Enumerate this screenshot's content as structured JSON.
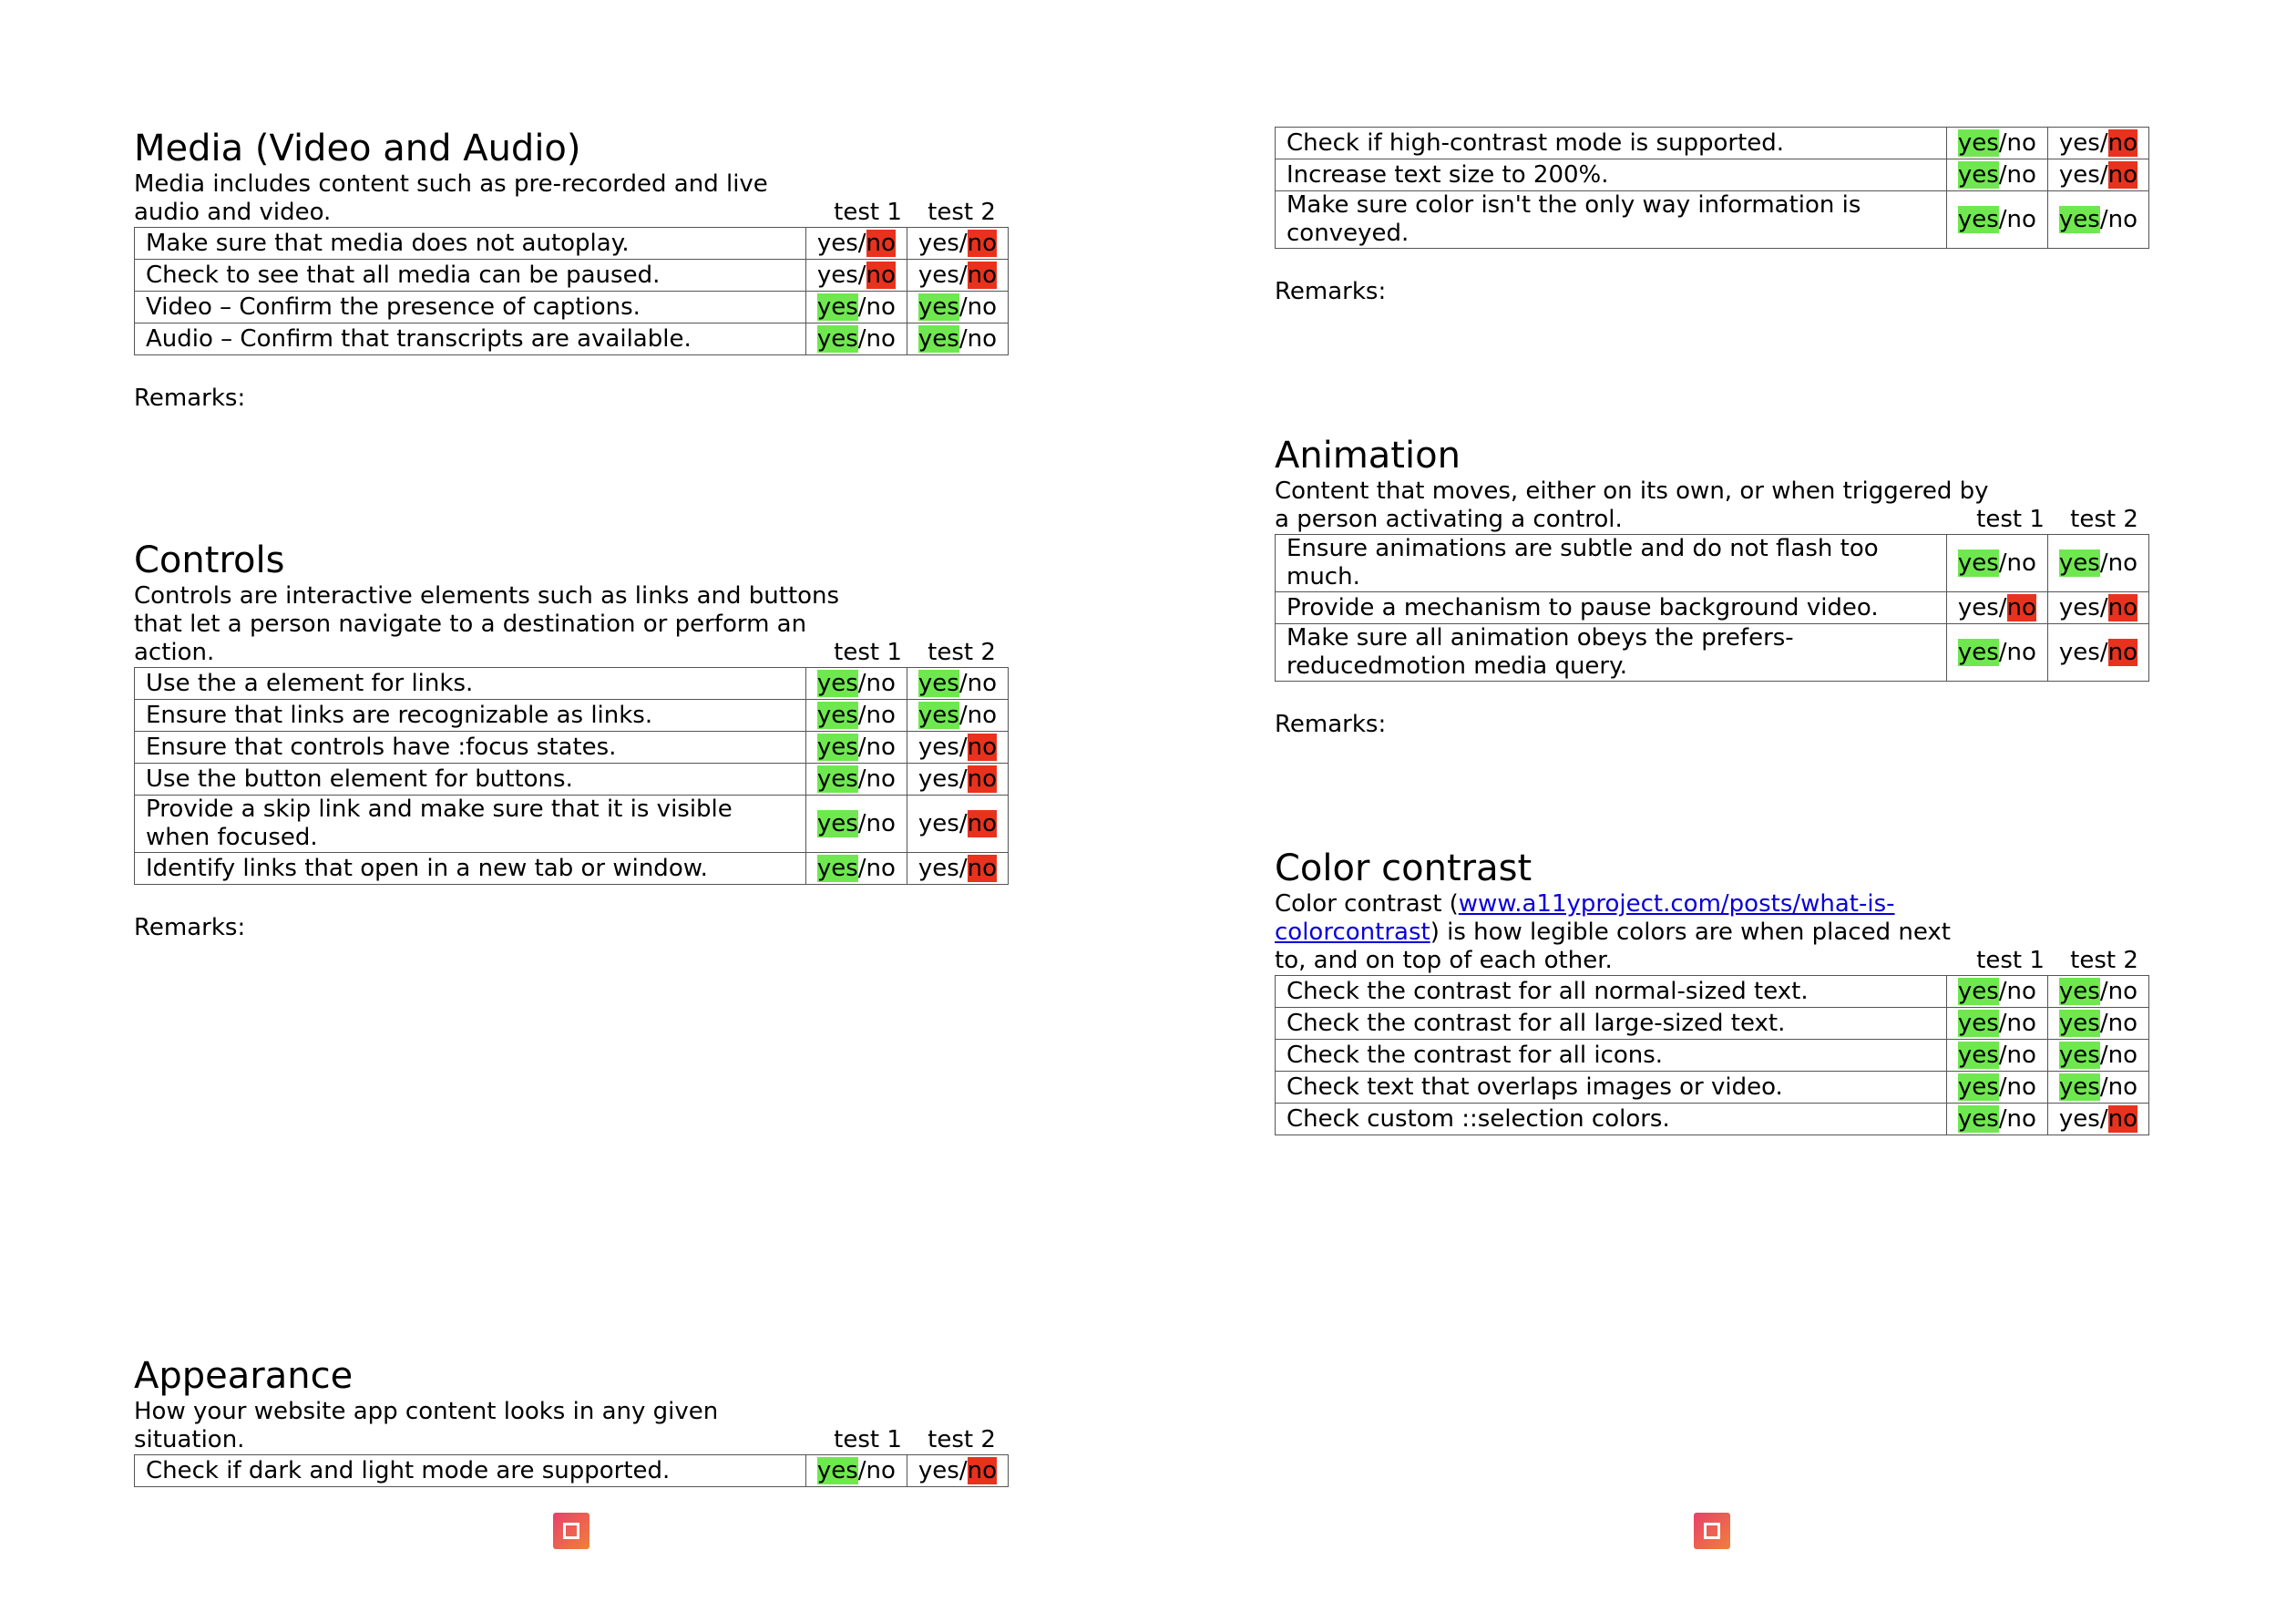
{
  "left_page": {
    "media": {
      "title": "Media (Video and Audio)",
      "description": "Media includes content such as pre-recorded and live audio and video.",
      "headers": [
        "test 1",
        "test 2"
      ],
      "rows": [
        {
          "question": "Make sure that media does not autoplay.",
          "test1": "no",
          "test2": "no"
        },
        {
          "question": "Check to see that all media can be paused.",
          "test1": "no",
          "test2": "no"
        },
        {
          "question": "Video – Confirm the presence of captions.",
          "test1": "yes",
          "test2": "yes"
        },
        {
          "question": "Audio – Confirm that transcripts are available.",
          "test1": "yes",
          "test2": "yes"
        }
      ],
      "remarks": "Remarks:"
    },
    "controls": {
      "title": "Controls",
      "description": "Controls are interactive elements such as links and buttons that let a person navigate to a destination or perform an action.",
      "headers": [
        "test 1",
        "test 2"
      ],
      "rows": [
        {
          "question": "Use the a element for links.",
          "test1": "yes",
          "test2": "yes"
        },
        {
          "question": "Ensure that links are recognizable as links.",
          "test1": "yes",
          "test2": "yes"
        },
        {
          "question": "Ensure that controls have :focus states.",
          "test1": "yes",
          "test2": "no"
        },
        {
          "question": "Use the button element for buttons.",
          "test1": "yes",
          "test2": "no"
        },
        {
          "question": "Provide a skip link and make sure that it is visible when focused.",
          "test1": "yes",
          "test2": "no"
        },
        {
          "question": "Identify links that open in a new tab or window.",
          "test1": "yes",
          "test2": "no"
        }
      ],
      "remarks": "Remarks:"
    },
    "appearance": {
      "title": "Appearance",
      "description": "How your website app content looks in any given situation.",
      "headers": [
        "test 1",
        "test 2"
      ],
      "rows": [
        {
          "question": "Check if dark and light mode are supported.",
          "test1": "yes",
          "test2": "no"
        }
      ]
    }
  },
  "right_page": {
    "appearance_continued": {
      "rows": [
        {
          "question": "Check if high-contrast mode is supported.",
          "test1": "yes",
          "test2": "no"
        },
        {
          "question": "Increase text size to 200%.",
          "test1": "yes",
          "test2": "no"
        },
        {
          "question": "Make sure color isn't the only way information is conveyed.",
          "test1": "yes",
          "test2": "yes"
        }
      ],
      "remarks": "Remarks:"
    },
    "animation": {
      "title": "Animation",
      "description": "Content that moves, either on its own, or when triggered by a person activating a control.",
      "headers": [
        "test 1",
        "test 2"
      ],
      "rows": [
        {
          "question": "Ensure animations are subtle and do not flash too much.",
          "test1": "yes",
          "test2": "yes"
        },
        {
          "question": "Provide a mechanism to pause background video.",
          "test1": "no",
          "test2": "no"
        },
        {
          "question": "Make sure all animation obeys the prefers-reducedmotion media query.",
          "test1": "yes",
          "test2": "no"
        }
      ],
      "remarks": "Remarks:"
    },
    "color_contrast": {
      "title": "Color contrast",
      "description_prefix": "Color contrast (",
      "link_text": "www.a11yproject.com/posts/what-is-colorcontrast",
      "description_suffix": ") is how legible colors are when placed next to, and on top of each other.",
      "headers": [
        "test 1",
        "test 2"
      ],
      "rows": [
        {
          "question": "Check the contrast for all normal-sized text.",
          "test1": "yes",
          "test2": "yes"
        },
        {
          "question": "Check the contrast for all large-sized text.",
          "test1": "yes",
          "test2": "yes"
        },
        {
          "question": "Check the contrast for all icons.",
          "test1": "yes",
          "test2": "yes"
        },
        {
          "question": "Check text that overlaps images or video.",
          "test1": "yes",
          "test2": "yes"
        },
        {
          "question": "Check custom ::selection colors.",
          "test1": "yes",
          "test2": "no"
        }
      ]
    }
  },
  "labels": {
    "yes": "yes",
    "no": "no",
    "slash": "/"
  },
  "colors": {
    "yes_highlight": "#6fe84f",
    "no_highlight": "#e8321e",
    "link": "#0a00d8"
  },
  "icons": {
    "footer": "a11y-badge-icon"
  }
}
